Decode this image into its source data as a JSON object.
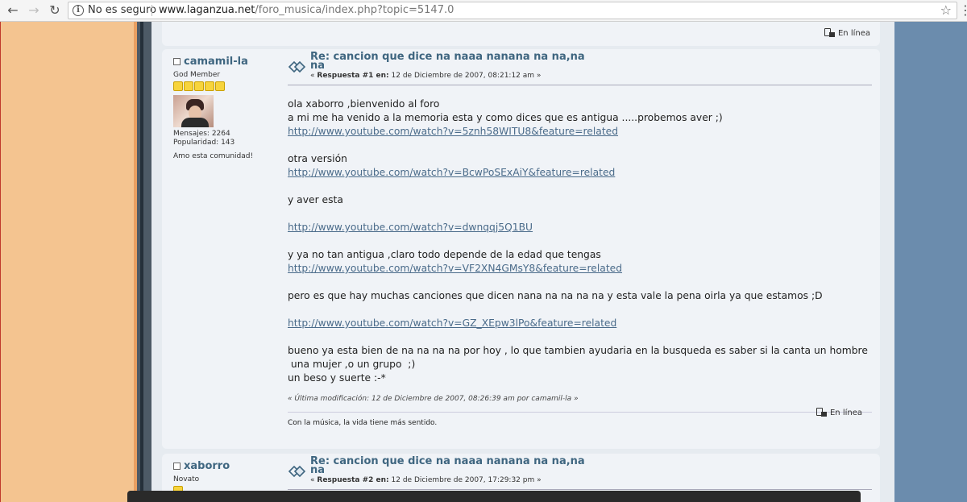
{
  "browser": {
    "security_label": "No es seguro",
    "url_host": "www.laganzua.net",
    "url_path": "/foro_musica/index.php?topic=5147.0"
  },
  "top_post": {
    "online_label": "En línea"
  },
  "post1": {
    "poster": {
      "name": "camamil-la",
      "group": "God Member",
      "stars": 5,
      "posts": "Mensajes: 2264",
      "popularity": "Popularidad: 143",
      "personal_text": "Amo esta comunidad!"
    },
    "subject": "Re: cancion que dice na naaa nanana na na,na na",
    "reply_prefix": "«",
    "reply_label": "Respuesta #1 en:",
    "reply_date": "12 de Diciembre de 2007, 08:21:12 am »",
    "body": {
      "l1": "ola xaborro ,bienvenido al foro",
      "l2": "a mi me ha venido a la memoria esta y como dices que es antigua .....probemos aver  ;)",
      "link1": "http://www.youtube.com/watch?v=5znh58WITU8&feature=related",
      "l3": "otra versión",
      "link2": "http://www.youtube.com/watch?v=BcwPoSExAiY&feature=related",
      "l4": "y aver esta",
      "link3": "http://www.youtube.com/watch?v=dwnqqj5Q1BU",
      "l5": "y ya no tan antigua ,claro todo depende de la edad que tengas",
      "link4": "http://www.youtube.com/watch?v=VF2XN4GMsY8&feature=related",
      "l6": "pero es que hay muchas canciones que dicen nana na na na na y esta vale la pena oirla ya que estamos  ;D",
      "link5": "http://www.youtube.com/watch?v=GZ_XEpw3lPo&feature=related",
      "l7": "bueno ya esta bien de na na  na na por hoy , lo que tambien ayudaria en la busqueda es saber si la canta un hombre",
      "l8": " una mujer ,o un grupo  ;)",
      "l9": "un beso y suerte  :-*"
    },
    "modified": "« Última modificación: 12 de Diciembre de 2007, 08:26:39 am por camamil-la »",
    "online_label": "En línea",
    "signature": "Con la música, la vida tiene más sentido."
  },
  "post2": {
    "poster": {
      "name": "xaborro",
      "group": "Novato",
      "stars": 1
    },
    "subject": "Re: cancion que dice na naaa nanana na na,na na",
    "reply_prefix": "«",
    "reply_label": "Respuesta #2 en:",
    "reply_date": "12 de Diciembre de 2007, 17:29:32 pm »"
  }
}
